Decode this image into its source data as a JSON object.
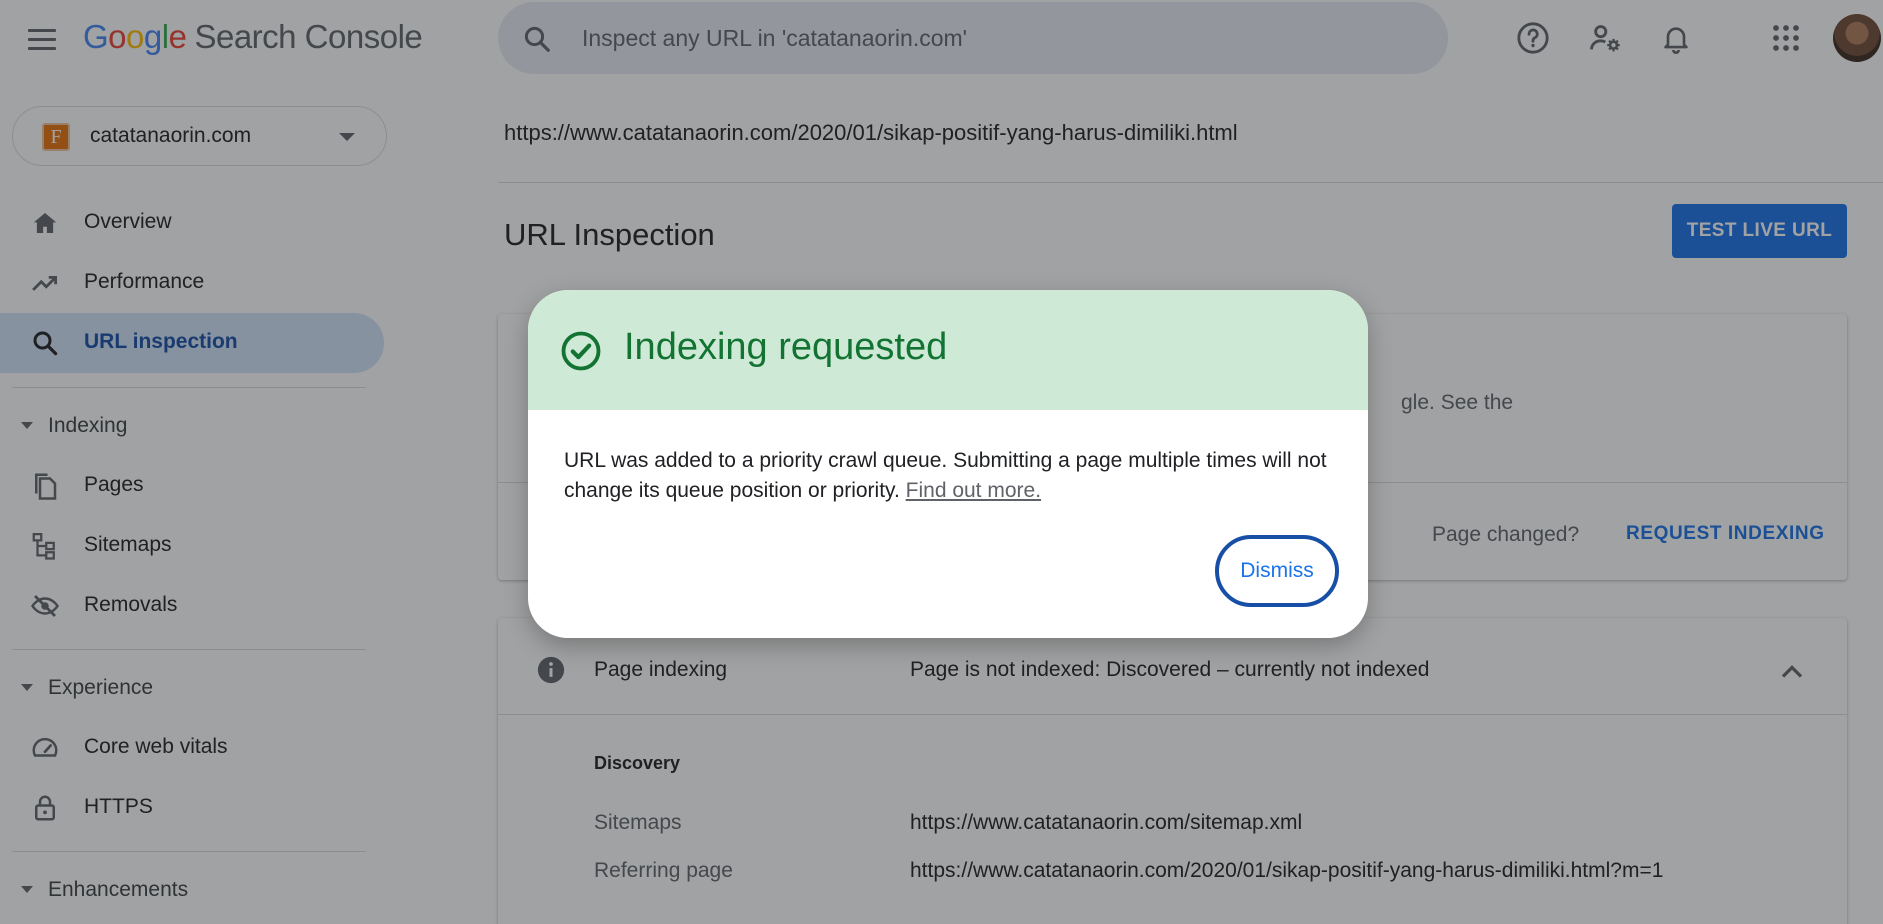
{
  "app": {
    "logo_letters": [
      "G",
      "o",
      "o",
      "g",
      "l",
      "e"
    ],
    "product": "Search Console"
  },
  "search": {
    "placeholder": "Inspect any URL in 'catatanaorin.com'"
  },
  "property": {
    "icon_letter": "F",
    "name": "catatanaorin.com"
  },
  "sidebar": {
    "items": [
      {
        "label": "Overview",
        "icon": "home-icon",
        "active": false
      },
      {
        "label": "Performance",
        "icon": "trending-up-icon",
        "active": false
      },
      {
        "label": "URL inspection",
        "icon": "search-icon",
        "active": true
      }
    ],
    "indexing": {
      "label": "Indexing",
      "items": [
        {
          "label": "Pages",
          "icon": "pages-icon"
        },
        {
          "label": "Sitemaps",
          "icon": "sitemap-icon"
        },
        {
          "label": "Removals",
          "icon": "visibility-off-icon"
        }
      ]
    },
    "experience": {
      "label": "Experience",
      "items": [
        {
          "label": "Core web vitals",
          "icon": "speed-gauge-icon"
        },
        {
          "label": "HTTPS",
          "icon": "lock-icon"
        }
      ]
    },
    "enhancements": {
      "label": "Enhancements"
    }
  },
  "main": {
    "inspected_url": "https://www.catatanaorin.com/2020/01/sikap-positif-yang-harus-dimiliki.html",
    "title": "URL Inspection",
    "test_live_url": "TEST LIVE URL",
    "card1": {
      "partial_text": "gle. See the",
      "page_changed": "Page changed?",
      "request_indexing": "REQUEST INDEXING"
    },
    "card2": {
      "title": "Page indexing",
      "status": "Page is not indexed: Discovered – currently not indexed",
      "discovery_heading": "Discovery",
      "sitemaps_label": "Sitemaps",
      "sitemaps_value": "https://www.catatanaorin.com/sitemap.xml",
      "referring_label": "Referring page",
      "referring_value": "https://www.catatanaorin.com/2020/01/sikap-positif-yang-harus-dimiliki.html?m=1"
    }
  },
  "dialog": {
    "title": "Indexing requested",
    "body": "URL was added to a priority crawl queue. Submitting a page multiple times will not change its queue position or priority. ",
    "link": "Find out more.",
    "dismiss": "Dismiss"
  },
  "colors": {
    "accent": "#1a73e8",
    "success_bg": "#ceead6",
    "success_text": "#137333",
    "active_nav_bg": "#d2e3fc"
  }
}
